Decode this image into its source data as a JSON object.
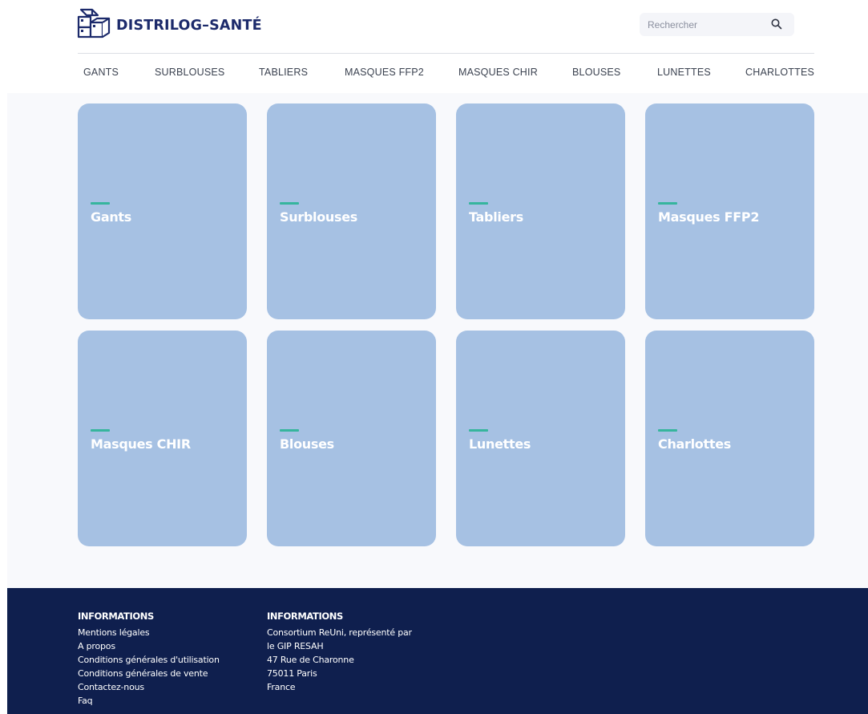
{
  "brand": {
    "name": "DISTRILOG–SANTÉ",
    "logo_icon": "boxes-logo-icon",
    "color": "#1c2a6b"
  },
  "search": {
    "placeholder": "Rechercher",
    "value": "",
    "icon": "search-icon"
  },
  "nav": {
    "items": [
      {
        "label": "GANTS"
      },
      {
        "label": "SURBLOUSES"
      },
      {
        "label": "TABLIERS"
      },
      {
        "label": "MASQUES FFP2"
      },
      {
        "label": "MASQUES CHIR"
      },
      {
        "label": "BLOUSES"
      },
      {
        "label": "LUNETTES"
      },
      {
        "label": "CHARLOTTES"
      }
    ]
  },
  "categories": [
    {
      "title": "Gants"
    },
    {
      "title": "Surblouses"
    },
    {
      "title": "Tabliers"
    },
    {
      "title": "Masques FFP2"
    },
    {
      "title": "Masques CHIR"
    },
    {
      "title": "Blouses"
    },
    {
      "title": "Lunettes"
    },
    {
      "title": "Charlottes"
    }
  ],
  "colors": {
    "card": "#a6c1e3",
    "accent": "#36b59d",
    "footer": "#0f1f4e"
  },
  "footer": {
    "col1": {
      "heading": "INFORMATIONS",
      "links": [
        "Mentions légales",
        "A propos",
        "Conditions générales d'utilisation",
        "Conditions générales de vente",
        "Contactez-nous",
        "Faq"
      ]
    },
    "col2": {
      "heading": "INFORMATIONS",
      "lines": [
        "Consortium ReUni, représenté par",
        "le GIP RESAH",
        "47 Rue de Charonne",
        "75011 Paris",
        "France"
      ]
    }
  }
}
